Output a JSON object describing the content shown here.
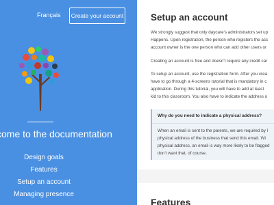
{
  "header": {
    "language_link": "Français",
    "create_button": "Create your account"
  },
  "sidebar": {
    "welcome": "come to the documentation",
    "nav": [
      {
        "label": "Design goals"
      },
      {
        "label": "Features"
      },
      {
        "label": "Setup an account"
      },
      {
        "label": "Managing presence"
      }
    ]
  },
  "content": {
    "title": "Setup an account",
    "para1": [
      "We strongly suggest that only daycare's administrators set up",
      "Happens. Upon registration, the person who registers the acc",
      "account owner is the one person who can add other users or"
    ],
    "para2": [
      "Creating an account is free and doesn't require any credit car"
    ],
    "para3": [
      "To setup an account, use the registration form. After you crea",
      "have to go through a 4-screens tutorial that is mandatory in c",
      "application. During this tutorial, you will have to add at least",
      "kid to this classroom. You also have to indicate the address o"
    ],
    "callout": {
      "title": "Why do you need to indicate a physical address?",
      "body": [
        "When an email is sent to the parents, we are required by l",
        "physical address of the business that send this email. Wi",
        "physical address, an email is way more likely to be flagged",
        "don't want that, of course."
      ]
    },
    "next_heading": "Features"
  },
  "colors": {
    "sidebar_bg": "#4a90e2",
    "content_bg": "#ffffff",
    "callout_bg": "#eef3f8"
  }
}
